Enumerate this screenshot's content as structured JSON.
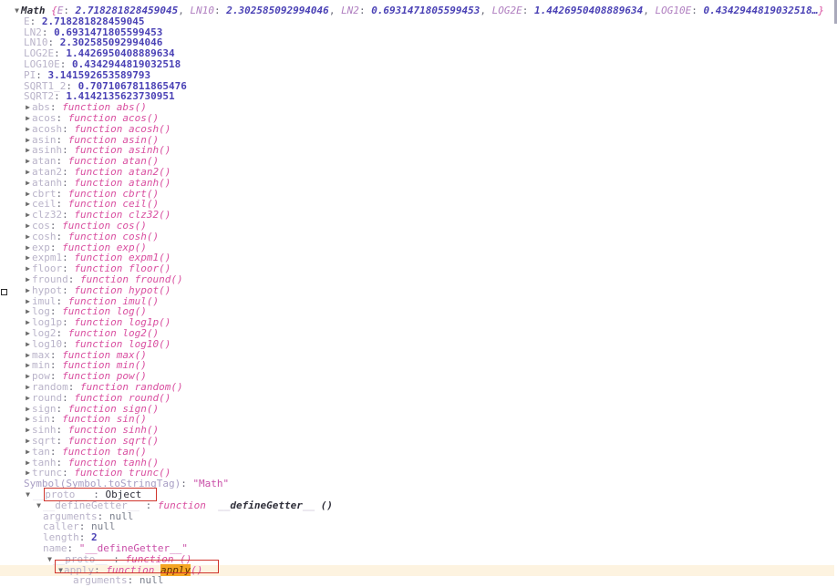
{
  "console": {
    "header": {
      "twisty": "▼",
      "object_name": "Math",
      "brace_open": "{",
      "preview": [
        {
          "key": "E",
          "value": "2.718281828459045"
        },
        {
          "key": "LN10",
          "value": "2.302585092994046"
        },
        {
          "key": "LN2",
          "value": "0.6931471805599453"
        },
        {
          "key": "LOG2E",
          "value": "1.4426950408889634"
        },
        {
          "key": "LOG10E",
          "value": "0.4342944819032518"
        }
      ],
      "ellipsis": "…",
      "brace_close": "}"
    },
    "constants": [
      {
        "key": "E",
        "value": "2.718281828459045"
      },
      {
        "key": "LN2",
        "value": "0.6931471805599453"
      },
      {
        "key": "LN10",
        "value": "2.302585092994046"
      },
      {
        "key": "LOG2E",
        "value": "1.4426950408889634"
      },
      {
        "key": "LOG10E",
        "value": "0.4342944819032518"
      },
      {
        "key": "PI",
        "value": "3.141592653589793"
      },
      {
        "key": "SQRT1_2",
        "value": "0.7071067811865476"
      },
      {
        "key": "SQRT2",
        "value": "1.4142135623730951"
      }
    ],
    "methods": [
      "abs",
      "acos",
      "acosh",
      "asin",
      "asinh",
      "atan",
      "atan2",
      "atanh",
      "cbrt",
      "ceil",
      "clz32",
      "cos",
      "cosh",
      "exp",
      "expm1",
      "floor",
      "fround",
      "hypot",
      "imul",
      "log",
      "log1p",
      "log2",
      "log10",
      "max",
      "min",
      "pow",
      "random",
      "round",
      "sign",
      "sin",
      "sinh",
      "sqrt",
      "tan",
      "tanh",
      "trunc"
    ],
    "method_prefix": "function",
    "symbol_row": {
      "key": "Symbol(Symbol.toStringTag)",
      "value": "\"Math\""
    },
    "proto_row": {
      "twisty": "▼",
      "key": "__proto__",
      "value": "Object"
    },
    "define_getter_row": {
      "twisty": "▼",
      "key": "__defineGetter__",
      "fn_keyword": "function",
      "fn_name": "__defineGetter__",
      "parens": "()"
    },
    "getter_props": [
      {
        "key": "arguments",
        "value": "null"
      },
      {
        "key": "caller",
        "value": "null"
      },
      {
        "key": "length",
        "value": "2"
      },
      {
        "key": "name",
        "value": "\"__defineGetter__\""
      }
    ],
    "inner_proto_row": {
      "twisty": "▼",
      "key": "__proto__",
      "fn_keyword": "function",
      "parens": "()"
    },
    "apply_row": {
      "twisty": "▼",
      "key": "apply",
      "fn_keyword": "function",
      "fn_name": "apply",
      "parens": "()"
    },
    "apply_child": {
      "key": "arguments",
      "value": "null"
    },
    "twisty_collapsed": "▶",
    "colon": ":"
  },
  "annotations": {
    "box_color": "#d0342c",
    "highlight_row_color": "#fdf3e0",
    "highlight_word_color": "#f5a623"
  }
}
